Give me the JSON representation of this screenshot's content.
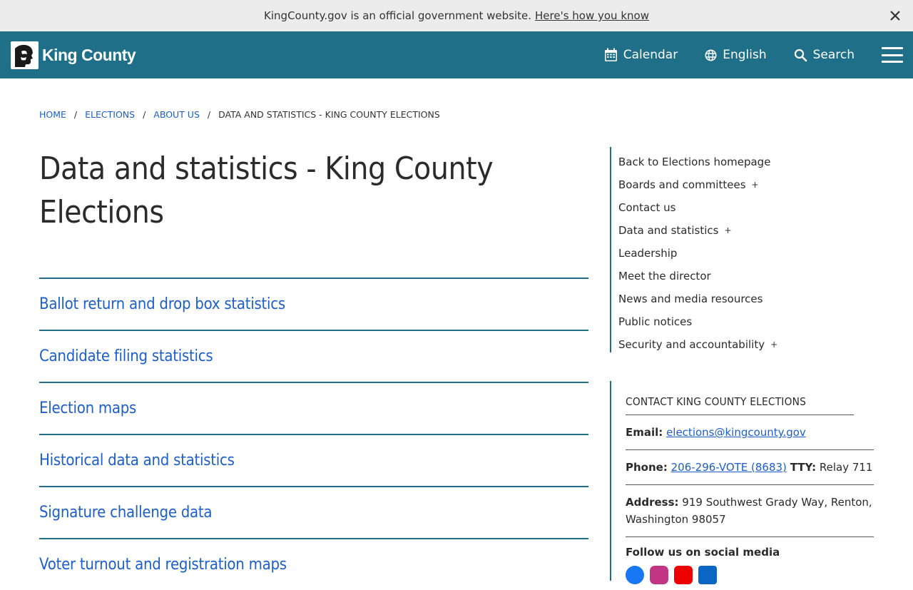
{
  "banner": {
    "text": "KingCounty.gov is an official government website.",
    "link": "Here's how you know"
  },
  "header": {
    "logo_text": "King County",
    "calendar": "Calendar",
    "language": "English",
    "search": "Search"
  },
  "breadcrumb": {
    "home": "HOME",
    "elections": "ELECTIONS",
    "about": "ABOUT US",
    "current": "DATA AND STATISTICS - KING COUNTY ELECTIONS",
    "separator": "/"
  },
  "main": {
    "title_line1": "Data and statistics - King County",
    "title_line2": "Elections",
    "links": [
      "Ballot return and drop box statistics",
      "Candidate filing statistics",
      "Election maps",
      "Historical data and statistics",
      "Signature challenge data",
      "Voter turnout and registration maps"
    ]
  },
  "sidebar": {
    "plus": "+",
    "items": [
      "Back to Elections homepage",
      "Boards and committees",
      "Contact us",
      "Data and statistics",
      "Leadership",
      "Meet the director",
      "News and media resources",
      "Public notices",
      "Security and accountability"
    ]
  },
  "contact": {
    "title": "CONTACT KING COUNTY ELECTIONS",
    "email_label": "Email:",
    "email": "elections@kingcounty.gov",
    "phone_label": "Phone:",
    "phone": "206-296-VOTE (8683)",
    "tty_label": "TTY:",
    "tty": "Relay 711",
    "address_label": "Address:",
    "address": "919 Southwest Grady Way, Renton, Washington 98057",
    "social_title": "Follow us on social media"
  },
  "colors": {
    "header": "#1f6f89",
    "link": "#1c5fcc",
    "banner": "#ececec"
  }
}
